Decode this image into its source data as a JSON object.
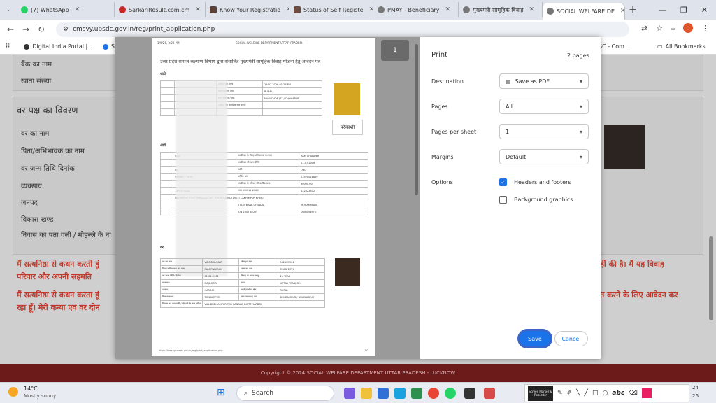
{
  "tabs": [
    {
      "label": "(7) WhatsApp",
      "color": "#25d366",
      "active": false
    },
    {
      "label": "SarkariResult.com.cm",
      "color": "#c62828",
      "active": false
    },
    {
      "label": "Know Your Registratio",
      "color": "#5d4037",
      "active": false
    },
    {
      "label": "Status of Self Registe",
      "color": "#6d4c41",
      "active": false
    },
    {
      "label": "PMAY - Beneficiary",
      "color": "#555555",
      "active": false
    },
    {
      "label": "मुख्यमंत्री सामूहिक विवाह",
      "color": "#555555",
      "active": false
    },
    {
      "label": "SOCIAL WELFARE DE",
      "color": "#555555",
      "active": true
    }
  ],
  "url": "cmsvy.upsdc.gov.in/reg/print_application.php",
  "bookmarks": {
    "first": "Digital India Portal |...",
    "second": "Sc",
    "third": "SC - Com...",
    "all": "All Bookmarks"
  },
  "page": {
    "bank_name": "बैंक का नाम",
    "account_no": "खाता संख्या",
    "groom_section": "वर पक्ष का विवरण",
    "rows": [
      "वर का नाम",
      "पिता/अभिभावक का नाम",
      "वर जन्म तिथि दिनांक",
      "व्यवसाय",
      "जनपद",
      "विकास खण्ड",
      "निवास का पता गली / मोहल्ले के ना"
    ],
    "decl1a": "मैं सत्यनिष्ठा से कथन करती हूं",
    "decl1b": "परिवार और अपनी सहमति",
    "decl1c": "हीं की है। मैं यह विवाह",
    "decl2a": "मैं सत्यनिष्ठा से कथन करता हूं",
    "decl2b": "रहा हूँ। मेरी कन्या एवं वर दोन",
    "decl2c": "त करने के लिए आवेदन कर",
    "copyright": "Copyright © 2024 SOCIAL WELFARE DEPARTMENT UTTAR PRADESH - LUCKNOW"
  },
  "preview": {
    "header_left": "1/9/26, 3:23 PM",
    "header_center": "SOCIAL WELFARE DEPARTMENT UTTAR PRADESH",
    "title": "उत्तर प्रदेश समाज कल्याण विभाग द्वारा संचालित मुख्यमंत्री सामूहिक विवाह योजना हेतु आवेदन पत्र",
    "sec1": "आवे",
    "sec2": "आवे",
    "sec3": "वर",
    "t1": [
      [
        "आवेदन की तिथि",
        "19-07-2026 03:25 PM"
      ],
      [
        "शहरी/ग्रामीण क्षेत्र",
        "RURAL"
      ],
      [
        "ग्राम पंचायत / वार्ड",
        "NAHI CHOR JAT / CHNHAPUR"
      ],
      [
        "आवेदन का वैवाहिक स्तर प्रकार",
        "-"
      ]
    ],
    "t2": [
      [
        "RAM",
        "आवेदिका के पिता/अभिभावक का नाम",
        "RAM CHANDER"
      ],
      [
        "",
        "आवेदिका की जन्म तिथि",
        "01-07-2006"
      ],
      [
        "EM",
        "जाति",
        "OBC"
      ],
      [
        "9988827 5838",
        "वार्षिक आय",
        "23520016889"
      ],
      [
        "",
        "आवेदिका के परिवार की वार्षिक आय",
        "30000.00"
      ],
      [
        "1997R35262",
        "आय प्रमाण पत्र का क्रम",
        "122422502"
      ],
      [
        "",
        "NAHARPUR POST NAMADAI JAIT TEH MOHAMDI DISTT LAKHIMPUR KHERI",
        ""
      ],
      [
        "",
        "STATE BANK OF INDIA",
        "MOHAMMADI"
      ],
      [
        "",
        "ION 2007 8229",
        "UBIN0549751"
      ]
    ],
    "t3": [
      [
        "वर का नाम",
        "VINOD KUMAR",
        "मोबाइल नंबर",
        "9621X9901"
      ],
      [
        "पिता/अभिभावक का नाम",
        "RAM PRAKASH",
        "जन्म का नाम",
        "CHAN DEVI"
      ],
      [
        "वर जन्म तिथि दिनांक",
        "01-01-2001",
        "विवाह के समय आयु",
        "25 YEAR"
      ],
      [
        "व्यवसाय",
        "MAJDOORI",
        "राज्य",
        "UTTAR PRADESH"
      ],
      [
        "जनपद",
        "HARDOI",
        "शहरी/ग्रामीण क्षेत्र",
        "RURAL"
      ],
      [
        "विकास खण्ड",
        "TONDARPUR",
        "ग्राम पंचायत / वार्ड",
        "BHUDAMPUR / BHUDAMPUR"
      ],
      [
        "निवास का पता गली / मोहल्ले के नाम सहित",
        "VILL BUDHAMPUR TEH SANDAD DISTT HARDOI",
        "",
        ""
      ]
    ],
    "signature": "परेकाशी",
    "footer_left": "https://cmsvy.upsdc.gov.in/reg/print_application.php",
    "footer_right": "1/2",
    "page_indicator": "1"
  },
  "print": {
    "title": "Print",
    "pages_count": "2 pages",
    "destination_label": "Destination",
    "destination_value": "Save as PDF",
    "pages_label": "Pages",
    "pages_value": "All",
    "pps_label": "Pages per sheet",
    "pps_value": "1",
    "margins_label": "Margins",
    "margins_value": "Default",
    "options_label": "Options",
    "opt1": "Headers and footers",
    "opt1_checked": true,
    "opt2": "Background graphics",
    "opt2_checked": false,
    "save": "Save",
    "cancel": "Cancel"
  },
  "taskbar": {
    "temp": "14°C",
    "weather": "Mostly sunny",
    "search": "Search",
    "clock1": "24",
    "clock2": "26",
    "marker_app": "Screen Marker & Recorder",
    "abc": "abc"
  },
  "colors": {
    "accent": "#1a73e8",
    "red": "#c0392b",
    "maroon": "#6d1a1a"
  }
}
